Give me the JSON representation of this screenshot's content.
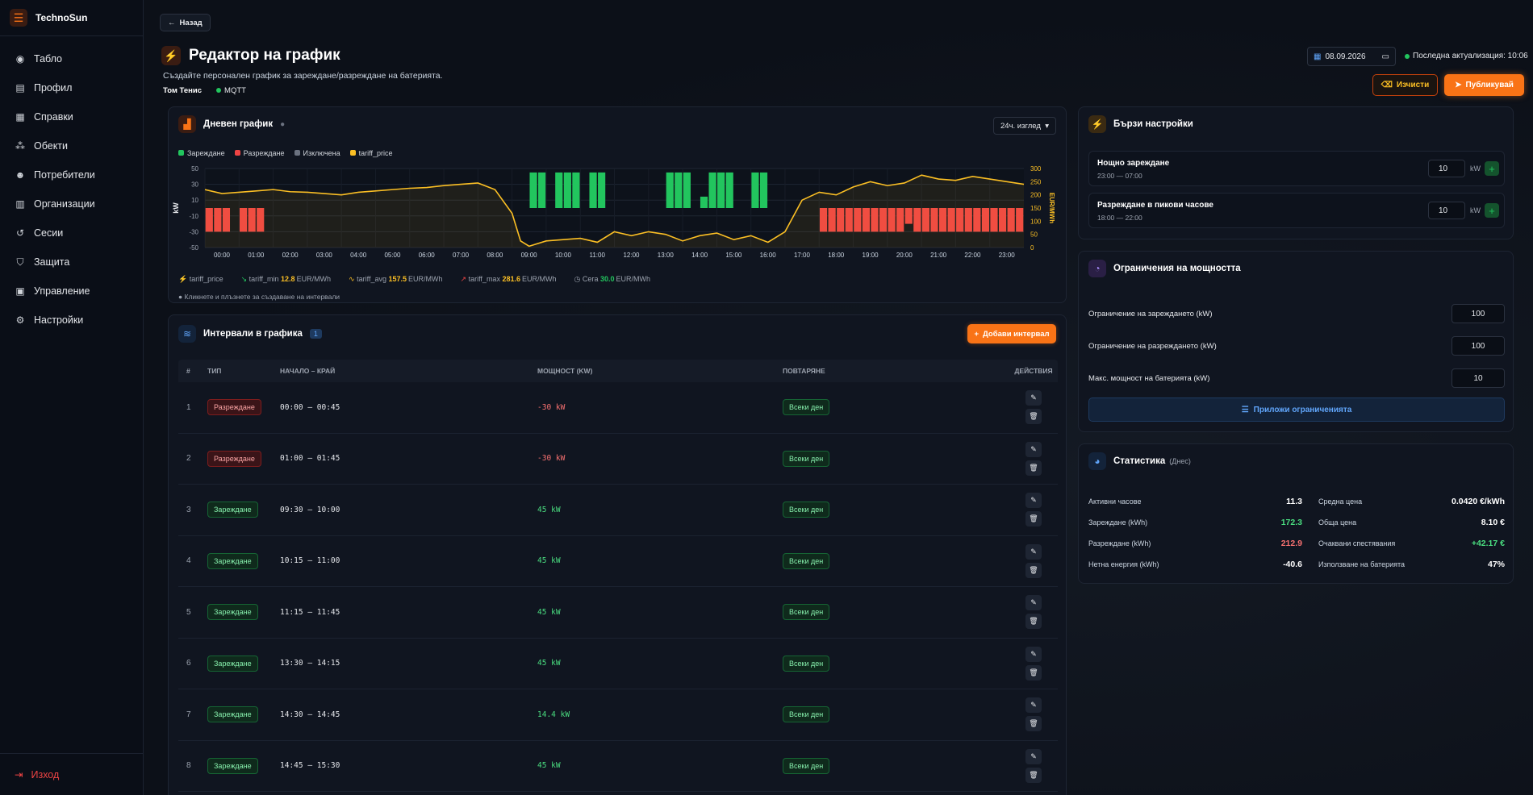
{
  "app": {
    "name": "TechnoSun"
  },
  "sidebar": {
    "items": [
      {
        "label": "Табло",
        "icon": "dashboard-icon"
      },
      {
        "label": "Профил",
        "icon": "profile-icon"
      },
      {
        "label": "Справки",
        "icon": "reports-icon"
      },
      {
        "label": "Обекти",
        "icon": "objects-icon"
      },
      {
        "label": "Потребители",
        "icon": "users-icon"
      },
      {
        "label": "Организации",
        "icon": "organizations-icon"
      },
      {
        "label": "Сесии",
        "icon": "sessions-icon"
      },
      {
        "label": "Защита",
        "icon": "shield-icon"
      },
      {
        "label": "Управление",
        "icon": "management-icon"
      },
      {
        "label": "Настройки",
        "icon": "gear-icon"
      }
    ],
    "logout": "Изход"
  },
  "header": {
    "back": "Назад",
    "title": "Редактор на график",
    "subtitle": "Създайте персонален график за зареждане/разреждане на батерията.",
    "user": "Том Тенис",
    "protocol": "MQTT",
    "date": "08.09.2026",
    "last_update": "Последна актуализация: 10:06",
    "clear": "Изчисти",
    "publish": "Публикувай"
  },
  "colors": {
    "charge": "#22c55e",
    "discharge": "#ef4444",
    "excluded": "#6b7280",
    "tariff": "#fbbf24",
    "accent": "#f97316"
  },
  "chart_panel": {
    "title": "Дневен график",
    "view_select": "24ч. изглед",
    "legend": [
      "Зареждане",
      "Разреждане",
      "Изключена",
      "tariff_price"
    ],
    "stats": {
      "tariff_price": "tariff_price",
      "min_label": "tariff_min",
      "min_val": "12.8",
      "min_unit": "EUR/MWh",
      "avg_label": "tariff_avg",
      "avg_val": "157.5",
      "avg_unit": "EUR/MWh",
      "max_label": "tariff_max",
      "max_val": "281.6",
      "max_unit": "EUR/MWh",
      "now_label": "Сега",
      "now_val": "30.0",
      "now_unit": "EUR/MWh"
    },
    "hint": "Кликнете и плъзнете за създаване на интервали"
  },
  "chart_data": {
    "type": "bar",
    "ylabel": "kW",
    "y2label": "EUR/MWh",
    "ylim": [
      -50,
      50
    ],
    "y2lim": [
      0,
      300
    ],
    "yticks": [
      50,
      30,
      10,
      -10,
      -30,
      -50
    ],
    "y2ticks": [
      300,
      250,
      200,
      150,
      100,
      50,
      0
    ],
    "xticks": [
      "00:00",
      "01:00",
      "02:00",
      "03:00",
      "04:00",
      "05:00",
      "06:00",
      "07:00",
      "08:00",
      "09:00",
      "10:00",
      "11:00",
      "12:00",
      "13:00",
      "14:00",
      "15:00",
      "16:00",
      "17:00",
      "18:00",
      "19:00",
      "20:00",
      "21:00",
      "22:00",
      "23:00"
    ],
    "bars": [
      {
        "start": 0.0,
        "end": 0.75,
        "value": -30
      },
      {
        "start": 1.0,
        "end": 1.75,
        "value": -30
      },
      {
        "start": 9.5,
        "end": 10.0,
        "value": 45
      },
      {
        "start": 10.25,
        "end": 11.0,
        "value": 45
      },
      {
        "start": 11.25,
        "end": 11.75,
        "value": 45
      },
      {
        "start": 13.5,
        "end": 14.25,
        "value": 45
      },
      {
        "start": 14.5,
        "end": 14.75,
        "value": 14.4
      },
      {
        "start": 14.75,
        "end": 15.5,
        "value": 45
      },
      {
        "start": 16.0,
        "end": 16.5,
        "value": 45
      },
      {
        "start": 18.0,
        "end": 20.5,
        "value": -30
      },
      {
        "start": 20.5,
        "end": 20.75,
        "value": -20
      },
      {
        "start": 20.75,
        "end": 24.0,
        "value": -30
      }
    ],
    "tariff_price": [
      [
        0,
        220
      ],
      [
        0.5,
        205
      ],
      [
        1,
        210
      ],
      [
        1.5,
        215
      ],
      [
        2,
        220
      ],
      [
        2.5,
        212
      ],
      [
        3,
        210
      ],
      [
        3.5,
        205
      ],
      [
        4,
        200
      ],
      [
        4.5,
        210
      ],
      [
        5,
        215
      ],
      [
        5.5,
        220
      ],
      [
        6,
        225
      ],
      [
        6.5,
        228
      ],
      [
        7,
        235
      ],
      [
        7.5,
        240
      ],
      [
        8,
        245
      ],
      [
        8.5,
        220
      ],
      [
        9,
        130
      ],
      [
        9.25,
        25
      ],
      [
        9.5,
        5
      ],
      [
        10,
        25
      ],
      [
        10.5,
        30
      ],
      [
        11,
        35
      ],
      [
        11.5,
        20
      ],
      [
        12,
        60
      ],
      [
        12.5,
        45
      ],
      [
        13,
        60
      ],
      [
        13.5,
        50
      ],
      [
        14,
        25
      ],
      [
        14.5,
        45
      ],
      [
        15,
        55
      ],
      [
        15.5,
        30
      ],
      [
        16,
        45
      ],
      [
        16.5,
        20
      ],
      [
        17,
        60
      ],
      [
        17.5,
        180
      ],
      [
        18,
        210
      ],
      [
        18.5,
        200
      ],
      [
        19,
        230
      ],
      [
        19.5,
        250
      ],
      [
        20,
        235
      ],
      [
        20.5,
        245
      ],
      [
        21,
        275
      ],
      [
        21.5,
        260
      ],
      [
        22,
        255
      ],
      [
        22.5,
        270
      ],
      [
        23,
        260
      ],
      [
        23.5,
        250
      ],
      [
        24,
        240
      ]
    ]
  },
  "intervals": {
    "title": "Интервали в графика",
    "count": "1",
    "add": "Добави интервал",
    "columns": [
      "#",
      "ТИП",
      "НАЧАЛО – КРАЙ",
      "МОЩНОСТ (KW)",
      "ПОВТАРЯНЕ",
      "ДЕЙСТВИЯ"
    ],
    "rows": [
      {
        "n": "1",
        "type": "Разреждане",
        "kind": "discharge",
        "range": "00:00 – 00:45",
        "power": "-30 kW",
        "repeat": "Всеки ден"
      },
      {
        "n": "2",
        "type": "Разреждане",
        "kind": "discharge",
        "range": "01:00 – 01:45",
        "power": "-30 kW",
        "repeat": "Всеки ден"
      },
      {
        "n": "3",
        "type": "Зареждане",
        "kind": "charge",
        "range": "09:30 – 10:00",
        "power": "45 kW",
        "repeat": "Всеки ден"
      },
      {
        "n": "4",
        "type": "Зареждане",
        "kind": "charge",
        "range": "10:15 – 11:00",
        "power": "45 kW",
        "repeat": "Всеки ден"
      },
      {
        "n": "5",
        "type": "Зареждане",
        "kind": "charge",
        "range": "11:15 – 11:45",
        "power": "45 kW",
        "repeat": "Всеки ден"
      },
      {
        "n": "6",
        "type": "Зареждане",
        "kind": "charge",
        "range": "13:30 – 14:15",
        "power": "45 kW",
        "repeat": "Всеки ден"
      },
      {
        "n": "7",
        "type": "Зареждане",
        "kind": "charge",
        "range": "14:30 – 14:45",
        "power": "14.4 kW",
        "repeat": "Всеки ден"
      },
      {
        "n": "8",
        "type": "Зареждане",
        "kind": "charge",
        "range": "14:45 – 15:30",
        "power": "45 kW",
        "repeat": "Всеки ден"
      }
    ]
  },
  "quick_settings": {
    "title": "Бързи настройки",
    "items": [
      {
        "title": "Нощно зареждане",
        "time": "23:00 — 07:00",
        "value": "10",
        "unit": "kW"
      },
      {
        "title": "Разреждане в пикови часове",
        "time": "18:00 — 22:00",
        "value": "10",
        "unit": "kW"
      }
    ]
  },
  "power_limits": {
    "title": "Ограничения на мощността",
    "rows": [
      {
        "label": "Ограничение на зареждането (kW)",
        "value": "100"
      },
      {
        "label": "Ограничение на разреждането (kW)",
        "value": "100"
      },
      {
        "label": "Макс. мощност на батерията (kW)",
        "value": "10"
      }
    ],
    "apply": "Приложи ограниченията"
  },
  "statistics": {
    "title": "Статистика",
    "period": "(Днес)",
    "rows": [
      {
        "l1": "Активни часове",
        "v1": "11.3",
        "l2": "Средна цена",
        "v2": "0.0420 €/kWh"
      },
      {
        "l1": "Зареждане (kWh)",
        "v1": "172.3",
        "l2": "Обща цена",
        "v2": "8.10 €"
      },
      {
        "l1": "Разреждане (kWh)",
        "v1": "212.9",
        "l2": "Очаквани спестявания",
        "v2": "+42.17 €"
      },
      {
        "l1": "Нетна енергия (kWh)",
        "v1": "-40.6",
        "l2": "Използване на батерията",
        "v2": "47%"
      }
    ]
  }
}
